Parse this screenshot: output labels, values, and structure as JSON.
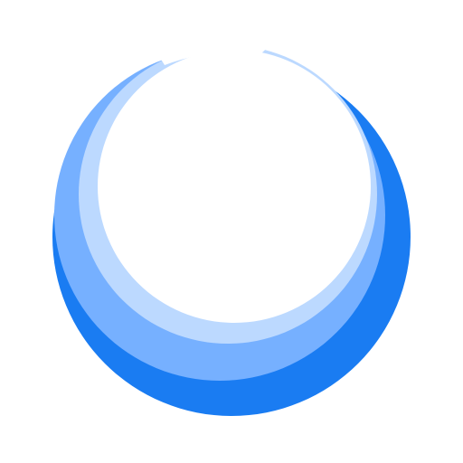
{
  "logo": {
    "icon": "crescent-rings-logo-icon",
    "colors": {
      "background": "#ffffff",
      "outer": "#1a7cf2",
      "middle": "#76b0ff",
      "inner": "#bcd9ff",
      "core": "#ffffff"
    }
  }
}
